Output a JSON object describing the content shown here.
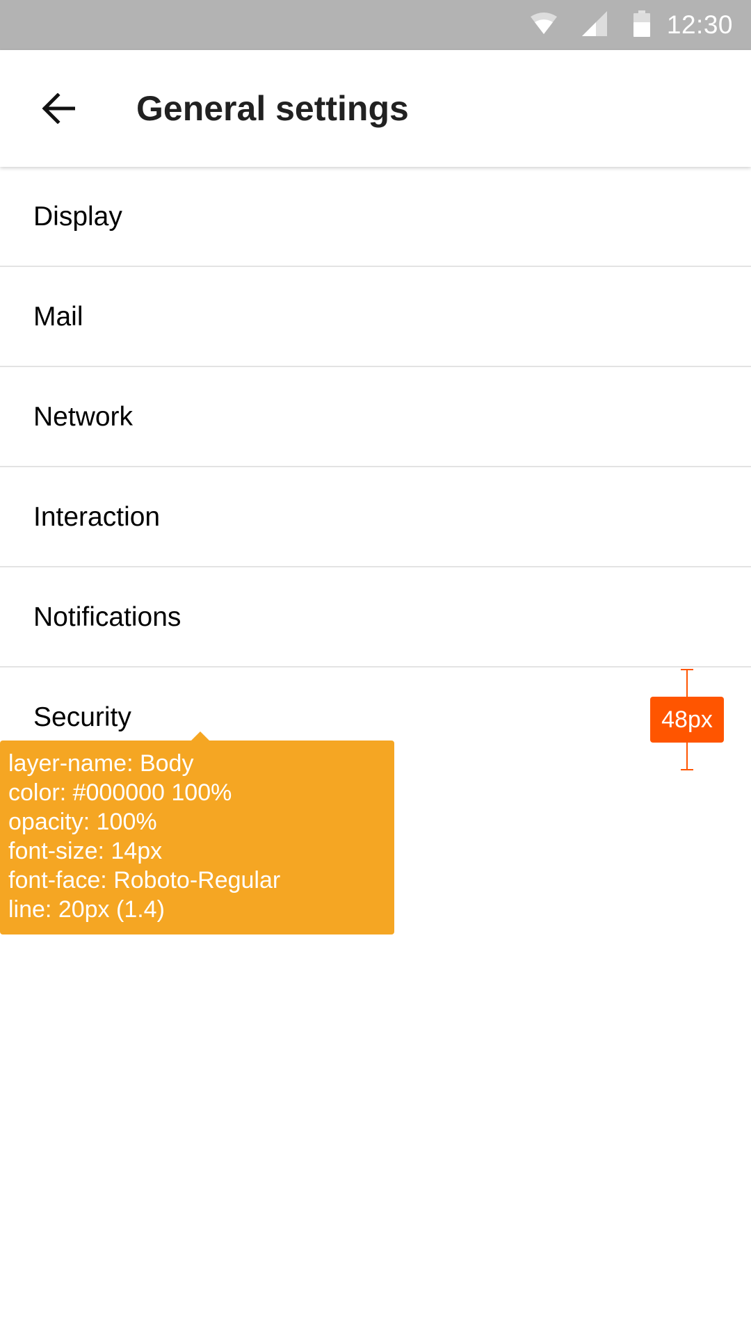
{
  "status_bar": {
    "time": "12:30",
    "icons": [
      "wifi-icon",
      "signal-icon",
      "battery-icon"
    ]
  },
  "app_bar": {
    "back_icon": "arrow-left-icon",
    "title": "General settings"
  },
  "settings_list": {
    "items": [
      {
        "label": "Display"
      },
      {
        "label": "Mail"
      },
      {
        "label": "Network"
      },
      {
        "label": "Interaction"
      },
      {
        "label": "Notifications"
      },
      {
        "label": "Security"
      }
    ]
  },
  "spec_tooltip": {
    "lines": [
      "layer-name: Body",
      "color: #000000 100%",
      "opacity: 100%",
      "font-size: 14px",
      "font-face: Roboto-Regular",
      "line: 20px (1.4)"
    ]
  },
  "measurement": {
    "label": "48px"
  },
  "colors": {
    "status_bar_bg": "#b3b3b3",
    "tooltip_bg": "#f5a623",
    "measure_accent": "#ff5500",
    "divider": "#e3e3e3",
    "title_text": "#212121",
    "body_text": "#000000"
  }
}
